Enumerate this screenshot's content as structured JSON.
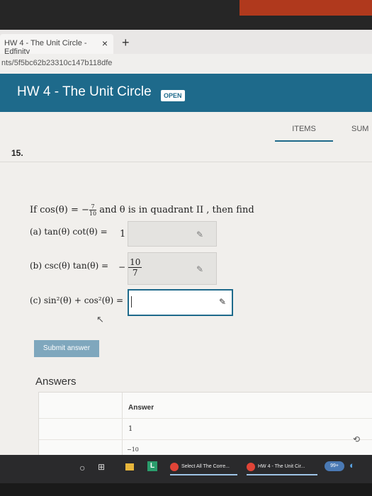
{
  "browser": {
    "tab_title": "HW 4 - The Unit Circle - Edfinity",
    "tab_close": "×",
    "new_tab": "+",
    "address": "nts/5f5bc62b23310c147b118dfe"
  },
  "header": {
    "title": "HW 4 - The Unit Circle",
    "badge": "OPEN",
    "accent_color": "#1e6a8b"
  },
  "nav": {
    "items_tab": "ITEMS",
    "sum_tab": "SUM"
  },
  "question": {
    "number": "15.",
    "prompt_start": "If cos(θ) = −",
    "prompt_frac_num": "7",
    "prompt_frac_den": "10",
    "prompt_end": "and θ is in quadrant II , then find",
    "part_a_label": "(a) tan(θ) cot(θ) =",
    "part_a_answer": "1",
    "part_b_label": "(b) csc(θ) tan(θ) =",
    "part_b_sign": "−",
    "part_b_num": "10",
    "part_b_den": "7",
    "part_c_label": "(c) sin²(θ) + cos²(θ) ="
  },
  "actions": {
    "submit_label": "Submit answer"
  },
  "answers": {
    "heading": "Answers",
    "column_header": "Answer",
    "row1": "1",
    "row2": "−10"
  },
  "taskbar": {
    "start_icon": "start-circle",
    "app1_label": "Select All The Corre...",
    "app2_label": "HW 4 - The Unit Cir...",
    "badge": "99+"
  }
}
